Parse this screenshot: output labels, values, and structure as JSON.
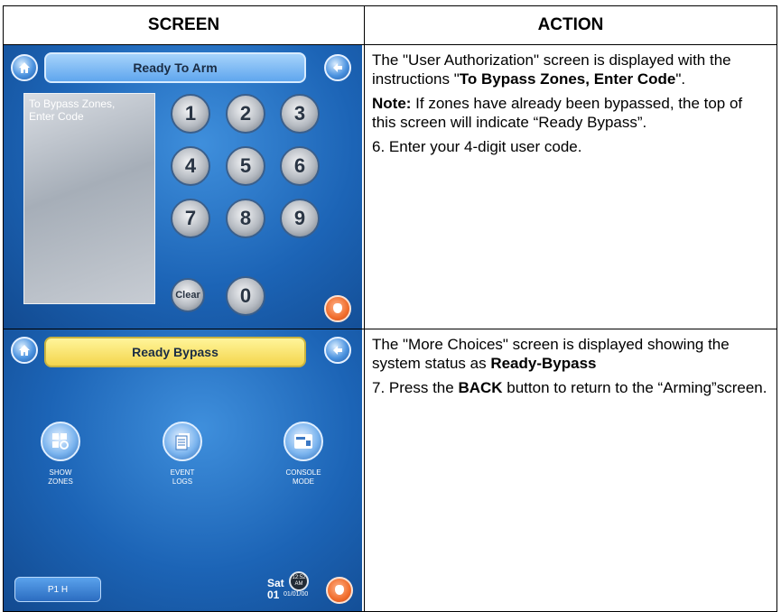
{
  "headers": {
    "screen": "SCREEN",
    "action": "ACTION"
  },
  "row1": {
    "screen": {
      "title": "Ready To Arm",
      "instruction_line1": "To Bypass Zones,",
      "instruction_line2": "Enter Code",
      "keypad": [
        "1",
        "2",
        "3",
        "4",
        "5",
        "6",
        "7",
        "8",
        "9"
      ],
      "clear_label": "Clear",
      "zero_label": "0"
    },
    "action": {
      "p1_a": "The \"User Authorization\" screen is displayed with the instructions \"",
      "p1_bold": "To Bypass Zones, Enter Code",
      "p1_b": "\".",
      "note_label": "Note:",
      "note_text": " If zones have already been bypassed, the top of this screen will indicate “Ready Bypass”.",
      "step6": "6.  Enter your 4-digit user code."
    }
  },
  "row2": {
    "screen": {
      "title": "Ready Bypass",
      "features": [
        {
          "line1": "SHOW",
          "line2": "ZONES"
        },
        {
          "line1": "EVENT",
          "line2": "LOGS"
        },
        {
          "line1": "CONSOLE",
          "line2": "MODE"
        }
      ],
      "p1h_label": "P1 H",
      "day": "Sat",
      "date_num": "01",
      "date_full": "01/01/00",
      "time": "12:52",
      "ampm": "AM"
    },
    "action": {
      "p1_a": "The \"More Choices\" screen is displayed showing the system status as ",
      "p1_bold": "Ready-Bypass",
      "step7_a": "7. Press the ",
      "step7_bold": "BACK",
      "step7_b": " button to return to the “Arming”screen."
    }
  }
}
